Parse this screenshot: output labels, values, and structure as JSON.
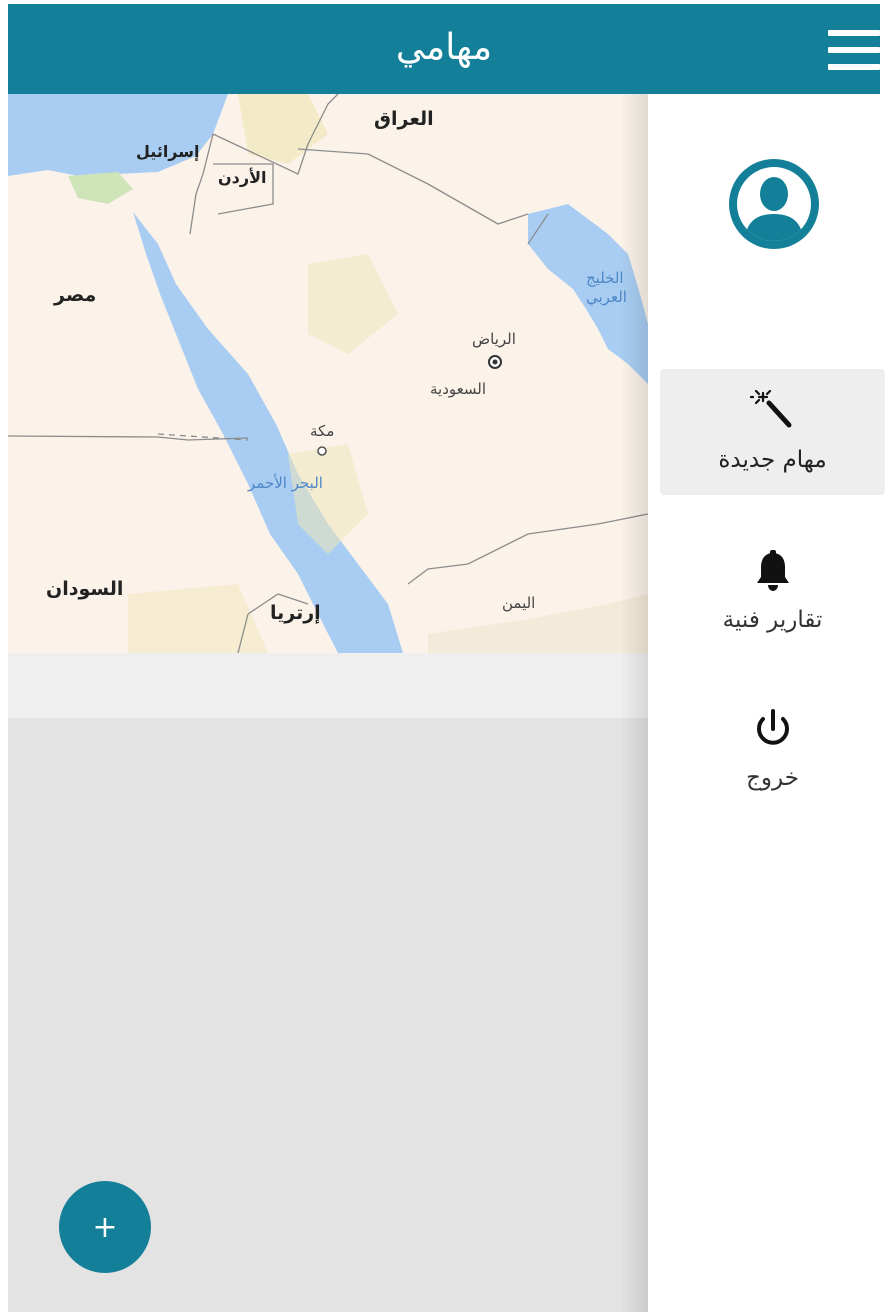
{
  "header": {
    "title": "مهامي",
    "menu_icon": "hamburger-menu-icon"
  },
  "map": {
    "labels": {
      "iraq": "العراق",
      "israel": "إسرائيل",
      "jordan": "الأردن",
      "egypt": "مصر",
      "gulf_line1": "الخليج",
      "gulf_line2": "العربي",
      "riyadh": "الرياض",
      "saudi": "السعودية",
      "mecca": "مكة",
      "red_sea": "البحر الأحمر",
      "sudan": "السودان",
      "yemen": "اليمن",
      "eritrea": "إرتريا"
    }
  },
  "drawer": {
    "avatar_icon": "user-avatar-icon",
    "items": [
      {
        "label": "مهام جديدة",
        "icon": "magic-wand-icon",
        "active": true
      },
      {
        "label": "تقارير فنية",
        "icon": "bell-icon",
        "active": false
      },
      {
        "label": "خروج",
        "icon": "power-icon",
        "active": false
      }
    ]
  },
  "fab": {
    "label": "+",
    "icon": "plus-icon"
  },
  "colors": {
    "primary": "#137f98",
    "map_land": "#fbf3ea",
    "map_water": "#a9cdf2",
    "active_item": "#eeeeee"
  }
}
